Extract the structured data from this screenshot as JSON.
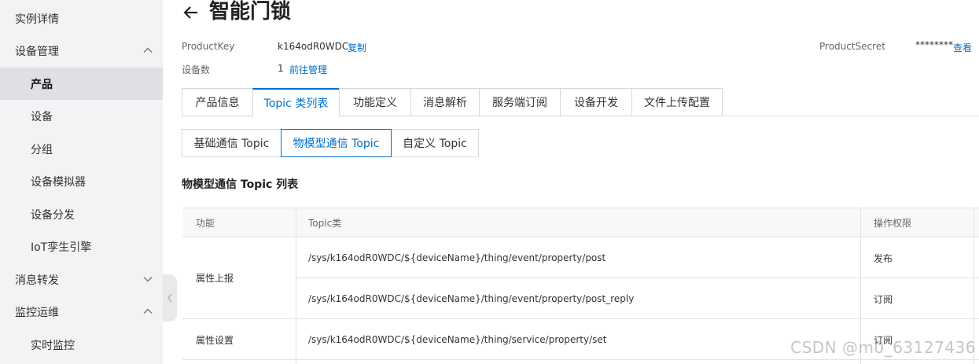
{
  "sidebar": {
    "items": [
      {
        "label": "实例详情",
        "level": 1
      },
      {
        "label": "设备管理",
        "level": 1,
        "chevron": "chevron-up-icon"
      },
      {
        "label": "产品",
        "level": 2,
        "active": true
      },
      {
        "label": "设备",
        "level": 2
      },
      {
        "label": "分组",
        "level": 2
      },
      {
        "label": "设备模拟器",
        "level": 2
      },
      {
        "label": "设备分发",
        "level": 2
      },
      {
        "label": "IoT孪生引擎",
        "level": 2
      },
      {
        "label": "消息转发",
        "level": 1,
        "chevron": "chevron-down-icon"
      },
      {
        "label": "监控运维",
        "level": 1,
        "chevron": "chevron-up-icon"
      },
      {
        "label": "实时监控",
        "level": 2
      }
    ]
  },
  "header": {
    "title": "智能门锁",
    "product_key_label": "ProductKey",
    "product_key_value": "k164odR0WDC",
    "copy_label": "复制",
    "device_count_label": "设备数",
    "device_count_value": "1",
    "manage_link": "前往管理",
    "product_secret_label": "ProductSecret",
    "product_secret_value": "********",
    "view_link": "查看"
  },
  "tabs": [
    "产品信息",
    "Topic 类列表",
    "功能定义",
    "消息解析",
    "服务端订阅",
    "设备开发",
    "文件上传配置"
  ],
  "active_tab": 1,
  "subtabs": [
    "基础通信 Topic",
    "物模型通信 Topic",
    "自定义 Topic"
  ],
  "active_subtab": 1,
  "section_title": "物模型通信 Topic 列表",
  "table": {
    "headers": [
      "功能",
      "Topic类",
      "操作权限"
    ],
    "rows": [
      {
        "func": "属性上报",
        "topic": "/sys/k164odR0WDC/${deviceName}/thing/event/property/post",
        "perm": "发布"
      },
      {
        "func": "",
        "topic": "/sys/k164odR0WDC/${deviceName}/thing/event/property/post_reply",
        "perm": "订阅"
      },
      {
        "func": "属性设置",
        "topic": "/sys/k164odR0WDC/${deviceName}/thing/service/property/set",
        "perm": "订阅"
      }
    ]
  },
  "watermark": "CSDN @m0_63127436",
  "colors": {
    "accent": "#0070cc",
    "sidebar_bg": "#f2f3f5",
    "sidebar_active": "#dfe0e3"
  }
}
